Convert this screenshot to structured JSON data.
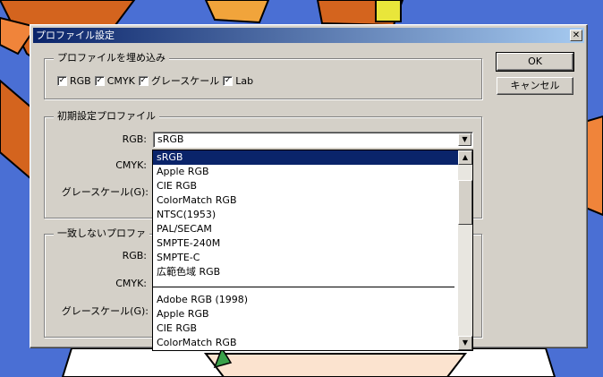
{
  "dialog": {
    "title": "プロファイル設定",
    "close_glyph": "✕",
    "ok_label": "OK",
    "cancel_label": "キャンセル"
  },
  "embed": {
    "legend": "プロファイルを埋め込み",
    "check_glyph": "✓",
    "items": [
      {
        "label": "RGB",
        "checked": true
      },
      {
        "label": "CMYK",
        "checked": true
      },
      {
        "label": "グレースケール",
        "checked": true
      },
      {
        "label": "Lab",
        "checked": true
      }
    ]
  },
  "defaults": {
    "legend": "初期設定プロファイル",
    "rgb_label": "RGB:",
    "rgb_value": "sRGB",
    "cmyk_label": "CMYK:",
    "gray_label": "グレースケール(G):"
  },
  "mismatch": {
    "legend": "一致しないプロファ",
    "rgb_label": "RGB:",
    "cmyk_label": "CMYK:",
    "gray_label": "グレースケール(G):"
  },
  "dropdown": {
    "group1": [
      "sRGB",
      "Apple RGB",
      "CIE RGB",
      "ColorMatch RGB",
      "NTSC(1953)",
      "PAL/SECAM",
      "SMPTE-240M",
      "SMPTE-C",
      "広範色域 RGB"
    ],
    "group2": [
      "Adobe RGB (1998)",
      "Apple RGB",
      "CIE RGB",
      "ColorMatch RGB"
    ],
    "selected": "sRGB",
    "arrow_up": "▲",
    "arrow_down": "▼"
  },
  "colors": {
    "desktop": "#4a6fd4",
    "titlebar_start": "#0a246a",
    "titlebar_end": "#a6caf0",
    "face": "#d4d0c8",
    "selection": "#0a246a"
  }
}
